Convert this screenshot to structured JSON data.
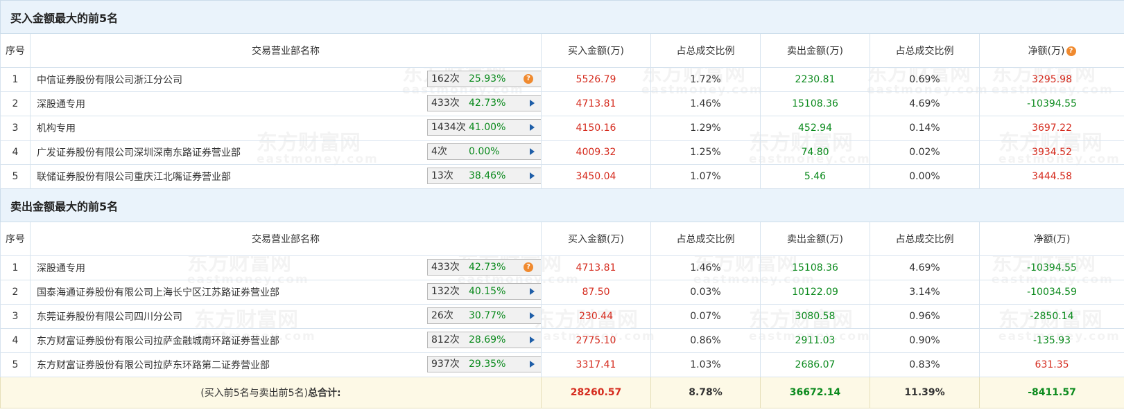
{
  "watermark": {
    "cn": "东方财富网",
    "en": "eastmoney.com"
  },
  "colors": {
    "section_bg": "#eaf3fb",
    "up": "#d52b1e",
    "down": "#0b8a1d",
    "total_bg": "#fdf9e6",
    "arrow": "#1e5ea8",
    "help": "#f08a2f"
  },
  "icons": {
    "help": "help-question-icon",
    "arrow": "play-arrow-icon"
  },
  "headers": {
    "seq": "序号",
    "name": "交易营业部名称",
    "buy": "买入金额(万)",
    "buy_ratio": "占总成交比例",
    "sell": "卖出金额(万)",
    "sell_ratio": "占总成交比例",
    "net": "净额(万)"
  },
  "buy_section": {
    "title": "买入金额最大的前5名",
    "rows": [
      {
        "seq": "1",
        "name": "中信证券股份有限公司浙江分公司",
        "count": "162次",
        "pct": "25.93%",
        "icon": "help",
        "buy": "5526.79",
        "buy_ratio": "1.72%",
        "sell": "2230.81",
        "sell_ratio": "0.69%",
        "net": "3295.98"
      },
      {
        "seq": "2",
        "name": "深股通专用",
        "count": "433次",
        "pct": "42.73%",
        "icon": "arrow",
        "buy": "4713.81",
        "buy_ratio": "1.46%",
        "sell": "15108.36",
        "sell_ratio": "4.69%",
        "net": "-10394.55"
      },
      {
        "seq": "3",
        "name": "机构专用",
        "count": "1434次",
        "pct": "41.00%",
        "icon": "arrow",
        "buy": "4150.16",
        "buy_ratio": "1.29%",
        "sell": "452.94",
        "sell_ratio": "0.14%",
        "net": "3697.22"
      },
      {
        "seq": "4",
        "name": "广发证券股份有限公司深圳深南东路证券营业部",
        "count": "4次",
        "pct": "0.00%",
        "icon": "arrow",
        "buy": "4009.32",
        "buy_ratio": "1.25%",
        "sell": "74.80",
        "sell_ratio": "0.02%",
        "net": "3934.52"
      },
      {
        "seq": "5",
        "name": "联储证券股份有限公司重庆江北嘴证券营业部",
        "count": "13次",
        "pct": "38.46%",
        "icon": "arrow",
        "buy": "3450.04",
        "buy_ratio": "1.07%",
        "sell": "5.46",
        "sell_ratio": "0.00%",
        "net": "3444.58"
      }
    ]
  },
  "sell_section": {
    "title": "卖出金额最大的前5名",
    "rows": [
      {
        "seq": "1",
        "name": "深股通专用",
        "count": "433次",
        "pct": "42.73%",
        "icon": "help",
        "buy": "4713.81",
        "buy_ratio": "1.46%",
        "sell": "15108.36",
        "sell_ratio": "4.69%",
        "net": "-10394.55"
      },
      {
        "seq": "2",
        "name": "国泰海通证券股份有限公司上海长宁区江苏路证券营业部",
        "count": "132次",
        "pct": "40.15%",
        "icon": "arrow",
        "buy": "87.50",
        "buy_ratio": "0.03%",
        "sell": "10122.09",
        "sell_ratio": "3.14%",
        "net": "-10034.59"
      },
      {
        "seq": "3",
        "name": "东莞证券股份有限公司四川分公司",
        "count": "26次",
        "pct": "30.77%",
        "icon": "arrow",
        "buy": "230.44",
        "buy_ratio": "0.07%",
        "sell": "3080.58",
        "sell_ratio": "0.96%",
        "net": "-2850.14"
      },
      {
        "seq": "4",
        "name": "东方财富证券股份有限公司拉萨金融城南环路证券营业部",
        "count": "812次",
        "pct": "28.69%",
        "icon": "arrow",
        "buy": "2775.10",
        "buy_ratio": "0.86%",
        "sell": "2911.03",
        "sell_ratio": "0.90%",
        "net": "-135.93"
      },
      {
        "seq": "5",
        "name": "东方财富证券股份有限公司拉萨东环路第二证券营业部",
        "count": "937次",
        "pct": "29.35%",
        "icon": "arrow",
        "buy": "3317.41",
        "buy_ratio": "1.03%",
        "sell": "2686.07",
        "sell_ratio": "0.83%",
        "net": "631.35"
      }
    ]
  },
  "total": {
    "label_prefix": "(买入前5名与卖出前5名)",
    "label_bold": "总合计:",
    "buy": "28260.57",
    "buy_ratio": "8.78%",
    "sell": "36672.14",
    "sell_ratio": "11.39%",
    "net": "-8411.57"
  }
}
